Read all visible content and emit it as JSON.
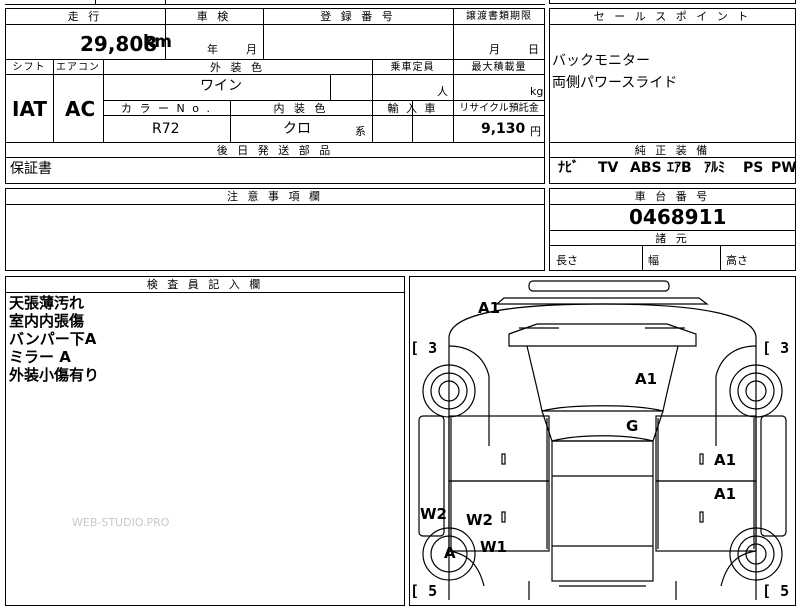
{
  "top_cut": "",
  "row1": {
    "mileage_label": "走 行",
    "mileage_value": "29,808",
    "mileage_unit": "km",
    "inspection_label": "車 検",
    "inspection_year": "年",
    "inspection_month": "月",
    "reg_label": "登 録 番 号",
    "transfer_label": "譲渡書類期限",
    "transfer_month": "月",
    "transfer_day": "日"
  },
  "row2": {
    "shift_label": "シフト",
    "shift_value": "IAT",
    "ac_label": "エアコン",
    "ac_value": "AC",
    "exterior_color_label": "外 装 色",
    "exterior_color_value": "ワイン",
    "capacity_label": "乗車定員",
    "capacity_unit": "人",
    "max_load_label": "最大積載量",
    "max_load_unit": "kg",
    "color_no_label": "カ ラ ー N o .",
    "color_no_value": "R72",
    "interior_label": "内 装 色",
    "interior_value": "クロ",
    "interior_suffix": "系",
    "import_label": "輸 入 車",
    "recycle_label": "リサイクル預託金",
    "recycle_value": "9,130",
    "recycle_unit": "円"
  },
  "delivery": {
    "label": "後 日 発 送 部 品",
    "value": "保証書"
  },
  "sales_points": {
    "label": "セ ー ル ス ポ イ ン ト",
    "lines": [
      "バックモニター",
      "両側パワースライド"
    ]
  },
  "equipment": {
    "label": "純 正 装 備",
    "items": [
      "ﾅﾋﾞ",
      "TV",
      "ABS",
      "ｴｱB",
      "ｱﾙﾐ",
      "PS",
      "PW"
    ]
  },
  "notes": {
    "label": "注 意 事 項 欄"
  },
  "chassis": {
    "label": "車 台 番 号",
    "value": "0468911"
  },
  "dimensions": {
    "label": "諸 元",
    "length": "長さ",
    "width": "幅",
    "height": "高さ"
  },
  "inspector": {
    "label": "検 査 員 記 入 欄",
    "lines": [
      "天張薄汚れ",
      "室内内張傷",
      "バンパー下A",
      "ミラー A",
      "外装小傷有り"
    ]
  },
  "diagram": {
    "marks": {
      "roof_front": "A1",
      "hood": "A1",
      "windshield": "G",
      "right_front_door": "A1",
      "right_rear_door": "A1",
      "left_rear_panel": "W2",
      "left_rear_door": "W2",
      "left_rear_fender": "W1",
      "left_rear_wheel": "A"
    },
    "tire_fl": "3",
    "tire_fr": "3",
    "tire_rl": "5",
    "tire_rr": "5"
  },
  "watermark": "WEB-STUDIO.PRO"
}
